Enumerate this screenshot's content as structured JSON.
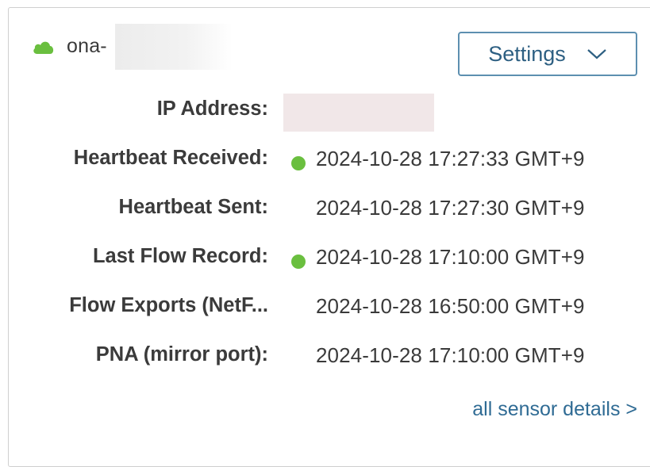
{
  "sensor": {
    "name_prefix": "ona-",
    "status_color": "#6abf3f",
    "icon": "cloud-icon"
  },
  "settings": {
    "label": "Settings",
    "icon": "chevron-down-icon",
    "accent": "#2d5f82"
  },
  "details": [
    {
      "label": "IP Address:",
      "value": "",
      "dot": false
    },
    {
      "label": "Heartbeat Received:",
      "value": "2024-10-28 17:27:33 GMT+9",
      "dot": true
    },
    {
      "label": "Heartbeat Sent:",
      "value": "2024-10-28 17:27:30 GMT+9",
      "dot": false
    },
    {
      "label": "Last Flow Record:",
      "value": "2024-10-28 17:10:00 GMT+9",
      "dot": true
    },
    {
      "label": "Flow Exports (NetF...",
      "value": "2024-10-28 16:50:00 GMT+9",
      "dot": false
    },
    {
      "label": "PNA (mirror port):",
      "value": "2024-10-28 17:10:00 GMT+9",
      "dot": false
    }
  ],
  "link": {
    "label": "all sensor details >"
  }
}
